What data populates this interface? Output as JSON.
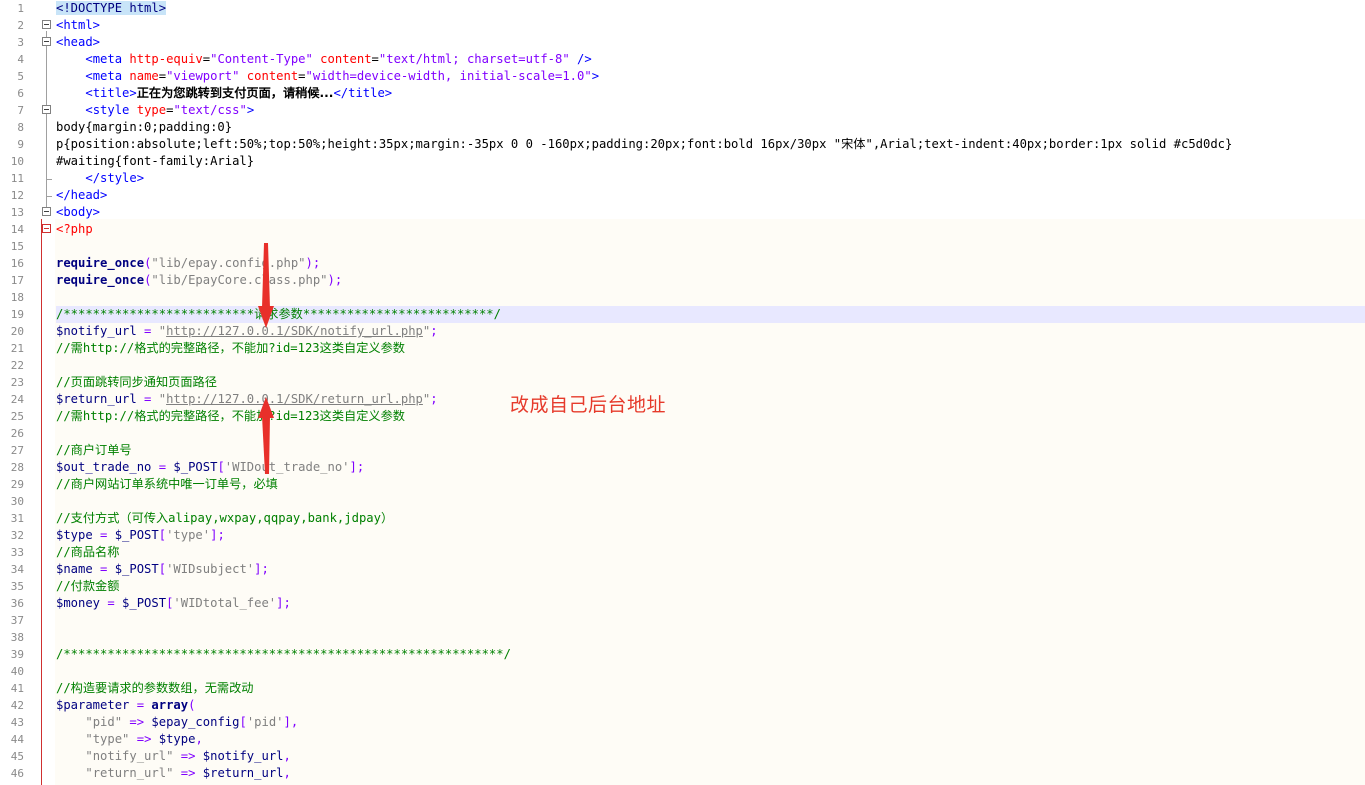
{
  "editor": {
    "lines": [
      {
        "n": "1",
        "segs": [
          {
            "t": "<!DOCTYPE html>",
            "c": "c-doct"
          }
        ]
      },
      {
        "n": "2",
        "segs": [
          {
            "t": "<html>",
            "c": "c-tag"
          }
        ]
      },
      {
        "n": "3",
        "segs": [
          {
            "t": "<head>",
            "c": "c-tag"
          }
        ]
      },
      {
        "n": "4",
        "segs": [
          {
            "t": "    "
          },
          {
            "t": "<meta ",
            "c": "c-tag"
          },
          {
            "t": "http-equiv",
            "c": "c-attr"
          },
          {
            "t": "=",
            "c": "c-plain"
          },
          {
            "t": "\"Content-Type\"",
            "c": "c-str"
          },
          {
            "t": " content",
            "c": "c-attr"
          },
          {
            "t": "=",
            "c": "c-plain"
          },
          {
            "t": "\"text/html; charset=utf-8\"",
            "c": "c-str"
          },
          {
            "t": " />",
            "c": "c-tag"
          }
        ]
      },
      {
        "n": "5",
        "segs": [
          {
            "t": "    "
          },
          {
            "t": "<meta ",
            "c": "c-tag"
          },
          {
            "t": "name",
            "c": "c-attr"
          },
          {
            "t": "=",
            "c": "c-plain"
          },
          {
            "t": "\"viewport\"",
            "c": "c-str"
          },
          {
            "t": " content",
            "c": "c-attr"
          },
          {
            "t": "=",
            "c": "c-plain"
          },
          {
            "t": "\"width=device-width, initial-scale=1.0\"",
            "c": "c-str"
          },
          {
            "t": ">",
            "c": "c-tag"
          }
        ]
      },
      {
        "n": "6",
        "segs": [
          {
            "t": "    "
          },
          {
            "t": "<title>",
            "c": "c-tag"
          },
          {
            "t": "正在为您跳转到支付页面，请稍候...",
            "c": "c-bold"
          },
          {
            "t": "</title>",
            "c": "c-tag"
          }
        ]
      },
      {
        "n": "7",
        "segs": [
          {
            "t": "    "
          },
          {
            "t": "<style ",
            "c": "c-tag"
          },
          {
            "t": "type",
            "c": "c-attr"
          },
          {
            "t": "=",
            "c": "c-plain"
          },
          {
            "t": "\"text/css\"",
            "c": "c-str"
          },
          {
            "t": ">",
            "c": "c-tag"
          }
        ]
      },
      {
        "n": "8",
        "segs": [
          {
            "t": "body{margin:0;padding:0}",
            "c": "c-plain"
          }
        ]
      },
      {
        "n": "9",
        "segs": [
          {
            "t": "p{position:absolute;left:50%;top:50%;height:35px;margin:-35px 0 0 -160px;padding:20px;font:bold 16px/30px \"宋体\",Arial;text-indent:40px;border:1px solid #c5d0dc}",
            "c": "c-plain"
          }
        ]
      },
      {
        "n": "10",
        "segs": [
          {
            "t": "#waiting{font-family:Arial}",
            "c": "c-plain"
          }
        ]
      },
      {
        "n": "11",
        "segs": [
          {
            "t": "    "
          },
          {
            "t": "</style>",
            "c": "c-tag"
          }
        ]
      },
      {
        "n": "12",
        "segs": [
          {
            "t": "</head>",
            "c": "c-tag"
          }
        ]
      },
      {
        "n": "13",
        "segs": [
          {
            "t": "<body>",
            "c": "c-tag"
          }
        ]
      },
      {
        "n": "14",
        "segs": [
          {
            "t": "<?php",
            "c": "c-php"
          }
        ]
      },
      {
        "n": "15",
        "segs": []
      },
      {
        "n": "16",
        "segs": [
          {
            "t": "require_once",
            "c": "c-kw"
          },
          {
            "t": "(",
            "c": "c-op"
          },
          {
            "t": "\"lib/epay.config.php\"",
            "c": "c-s"
          },
          {
            "t": ");",
            "c": "c-op"
          }
        ]
      },
      {
        "n": "17",
        "segs": [
          {
            "t": "require_once",
            "c": "c-kw"
          },
          {
            "t": "(",
            "c": "c-op"
          },
          {
            "t": "\"lib/EpayCore.class.php\"",
            "c": "c-s"
          },
          {
            "t": ");",
            "c": "c-op"
          }
        ]
      },
      {
        "n": "18",
        "segs": []
      },
      {
        "n": "19",
        "segs": [
          {
            "t": "/**************************请求参数**************************/",
            "c": "c-cm"
          }
        ]
      },
      {
        "n": "20",
        "segs": [
          {
            "t": "$notify_url",
            "c": "c-var"
          },
          {
            "t": " = ",
            "c": "c-op"
          },
          {
            "t": "\"",
            "c": "c-s"
          },
          {
            "t": "http://127.0.0.1/SDK/notify_url.php",
            "c": "c-url"
          },
          {
            "t": "\"",
            "c": "c-s"
          },
          {
            "t": ";",
            "c": "c-op"
          }
        ]
      },
      {
        "n": "21",
        "segs": [
          {
            "t": "//需http://格式的完整路径，不能加?id=123这类自定义参数",
            "c": "c-cm"
          }
        ]
      },
      {
        "n": "22",
        "segs": []
      },
      {
        "n": "23",
        "segs": [
          {
            "t": "//页面跳转同步通知页面路径",
            "c": "c-cm"
          }
        ]
      },
      {
        "n": "24",
        "segs": [
          {
            "t": "$return_url",
            "c": "c-var"
          },
          {
            "t": " = ",
            "c": "c-op"
          },
          {
            "t": "\"",
            "c": "c-s"
          },
          {
            "t": "http://127.0.0.1/SDK/return_url.php",
            "c": "c-url"
          },
          {
            "t": "\"",
            "c": "c-s"
          },
          {
            "t": ";",
            "c": "c-op"
          }
        ]
      },
      {
        "n": "25",
        "segs": [
          {
            "t": "//需http://格式的完整路径，不能加?id=123这类自定义参数",
            "c": "c-cm"
          }
        ]
      },
      {
        "n": "26",
        "segs": []
      },
      {
        "n": "27",
        "segs": [
          {
            "t": "//商户订单号",
            "c": "c-cm"
          }
        ]
      },
      {
        "n": "28",
        "segs": [
          {
            "t": "$out_trade_no",
            "c": "c-var"
          },
          {
            "t": " = ",
            "c": "c-op"
          },
          {
            "t": "$_POST",
            "c": "c-var"
          },
          {
            "t": "[",
            "c": "c-op"
          },
          {
            "t": "'WIDout_trade_no'",
            "c": "c-s"
          },
          {
            "t": "];",
            "c": "c-op"
          }
        ]
      },
      {
        "n": "29",
        "segs": [
          {
            "t": "//商户网站订单系统中唯一订单号，必填",
            "c": "c-cm"
          }
        ]
      },
      {
        "n": "30",
        "segs": []
      },
      {
        "n": "31",
        "segs": [
          {
            "t": "//支付方式（可传入alipay,wxpay,qqpay,bank,jdpay）",
            "c": "c-cm"
          }
        ]
      },
      {
        "n": "32",
        "segs": [
          {
            "t": "$type",
            "c": "c-var"
          },
          {
            "t": " = ",
            "c": "c-op"
          },
          {
            "t": "$_POST",
            "c": "c-var"
          },
          {
            "t": "[",
            "c": "c-op"
          },
          {
            "t": "'type'",
            "c": "c-s"
          },
          {
            "t": "];",
            "c": "c-op"
          }
        ]
      },
      {
        "n": "33",
        "segs": [
          {
            "t": "//商品名称",
            "c": "c-cm"
          }
        ]
      },
      {
        "n": "34",
        "segs": [
          {
            "t": "$name",
            "c": "c-var"
          },
          {
            "t": " = ",
            "c": "c-op"
          },
          {
            "t": "$_POST",
            "c": "c-var"
          },
          {
            "t": "[",
            "c": "c-op"
          },
          {
            "t": "'WIDsubject'",
            "c": "c-s"
          },
          {
            "t": "];",
            "c": "c-op"
          }
        ]
      },
      {
        "n": "35",
        "segs": [
          {
            "t": "//付款金额",
            "c": "c-cm"
          }
        ]
      },
      {
        "n": "36",
        "segs": [
          {
            "t": "$money",
            "c": "c-var"
          },
          {
            "t": " = ",
            "c": "c-op"
          },
          {
            "t": "$_POST",
            "c": "c-var"
          },
          {
            "t": "[",
            "c": "c-op"
          },
          {
            "t": "'WIDtotal_fee'",
            "c": "c-s"
          },
          {
            "t": "];",
            "c": "c-op"
          }
        ]
      },
      {
        "n": "37",
        "segs": []
      },
      {
        "n": "38",
        "segs": []
      },
      {
        "n": "39",
        "segs": [
          {
            "t": "/************************************************************/",
            "c": "c-cm"
          }
        ]
      },
      {
        "n": "40",
        "segs": []
      },
      {
        "n": "41",
        "segs": [
          {
            "t": "//构造要请求的参数数组，无需改动",
            "c": "c-cm"
          }
        ]
      },
      {
        "n": "42",
        "segs": [
          {
            "t": "$parameter",
            "c": "c-var"
          },
          {
            "t": " = ",
            "c": "c-op"
          },
          {
            "t": "array",
            "c": "c-kw"
          },
          {
            "t": "(",
            "c": "c-op"
          }
        ]
      },
      {
        "n": "43",
        "segs": [
          {
            "t": "    "
          },
          {
            "t": "\"pid\"",
            "c": "c-s"
          },
          {
            "t": " => ",
            "c": "c-op"
          },
          {
            "t": "$epay_config",
            "c": "c-var"
          },
          {
            "t": "[",
            "c": "c-op"
          },
          {
            "t": "'pid'",
            "c": "c-s"
          },
          {
            "t": "],",
            "c": "c-op"
          }
        ]
      },
      {
        "n": "44",
        "segs": [
          {
            "t": "    "
          },
          {
            "t": "\"type\"",
            "c": "c-s"
          },
          {
            "t": " => ",
            "c": "c-op"
          },
          {
            "t": "$type",
            "c": "c-var"
          },
          {
            "t": ",",
            "c": "c-op"
          }
        ]
      },
      {
        "n": "45",
        "segs": [
          {
            "t": "    "
          },
          {
            "t": "\"notify_url\"",
            "c": "c-s"
          },
          {
            "t": " => ",
            "c": "c-op"
          },
          {
            "t": "$notify_url",
            "c": "c-var"
          },
          {
            "t": ",",
            "c": "c-op"
          }
        ]
      },
      {
        "n": "46",
        "segs": [
          {
            "t": "    "
          },
          {
            "t": "\"return_url\"",
            "c": "c-s"
          },
          {
            "t": " => ",
            "c": "c-op"
          },
          {
            "t": "$return_url",
            "c": "c-var"
          },
          {
            "t": ",",
            "c": "c-op"
          }
        ]
      }
    ]
  },
  "annotation": {
    "text": "改成自己后台地址",
    "color": "#e63a2b"
  }
}
